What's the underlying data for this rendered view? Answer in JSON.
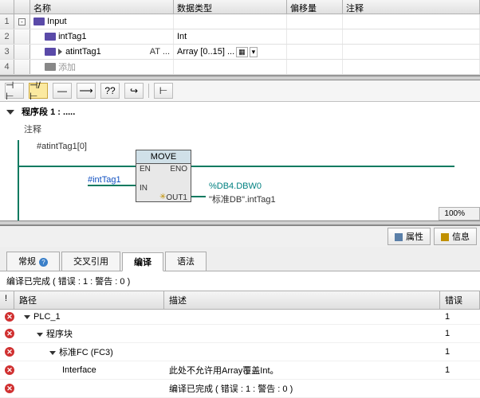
{
  "varTable": {
    "headers": {
      "name": "名称",
      "type": "数据类型",
      "offset": "偏移量",
      "comment": "注释"
    },
    "rows": [
      {
        "num": "1",
        "name": "Input",
        "type": "",
        "fold": "-",
        "chip": "purple"
      },
      {
        "num": "2",
        "name": "intTag1",
        "type": "Int",
        "chip": "purple",
        "indent": 1
      },
      {
        "num": "3",
        "name": "atintTag1",
        "at": "AT ...",
        "type": "Array [0..15] ...",
        "chip": "purple",
        "indent": 1,
        "tri": true,
        "dd": true
      },
      {
        "num": "4",
        "name": "添加",
        "chip": "gray",
        "indent": 1,
        "add": true
      }
    ]
  },
  "toolbar": {
    "btns": [
      "⊣ ⊢",
      "⊣/⊢",
      "—",
      "⟶",
      "??",
      "↪",
      "⊢"
    ]
  },
  "segment": {
    "title": "程序段 1 :   .....",
    "comment": "注释"
  },
  "ladder": {
    "block_title": "MOVE",
    "pins": {
      "en": "EN",
      "eno": "ENO",
      "in": "IN",
      "out1": "OUT1"
    },
    "in_top": "#atintTag1[0]",
    "in_left": "#intTag1",
    "out_addr": "%DB4.DBW0",
    "out_sym": "\"标准DB\".intTag1"
  },
  "zoom": "100%",
  "infoTabs": {
    "properties": "属性",
    "info": "信息"
  },
  "compileTabs": [
    "常规",
    "交叉引用",
    "编译",
    "语法"
  ],
  "compileStatus": "编译已完成 ( 错误 : 1 : 警告 : 0 )",
  "compHeaders": {
    "path": "路径",
    "desc": "描述",
    "err": "错误"
  },
  "compRows": [
    {
      "icon": true,
      "path": "PLC_1",
      "desc": "",
      "err": "1",
      "pad": 1,
      "tdn": true
    },
    {
      "icon": true,
      "path": "程序块",
      "desc": "",
      "err": "1",
      "pad": 2,
      "tdn": true
    },
    {
      "icon": true,
      "path": "标准FC (FC3)",
      "desc": "",
      "err": "1",
      "pad": 3,
      "tdn": true
    },
    {
      "icon": true,
      "path": "Interface",
      "desc": "此处不允许用Array覆盖Int。",
      "err": "1",
      "pad": 4
    },
    {
      "icon": true,
      "path": "",
      "desc": "编译已完成 ( 错误 : 1 : 警告 : 0 )",
      "err": "",
      "pad": 1
    }
  ]
}
